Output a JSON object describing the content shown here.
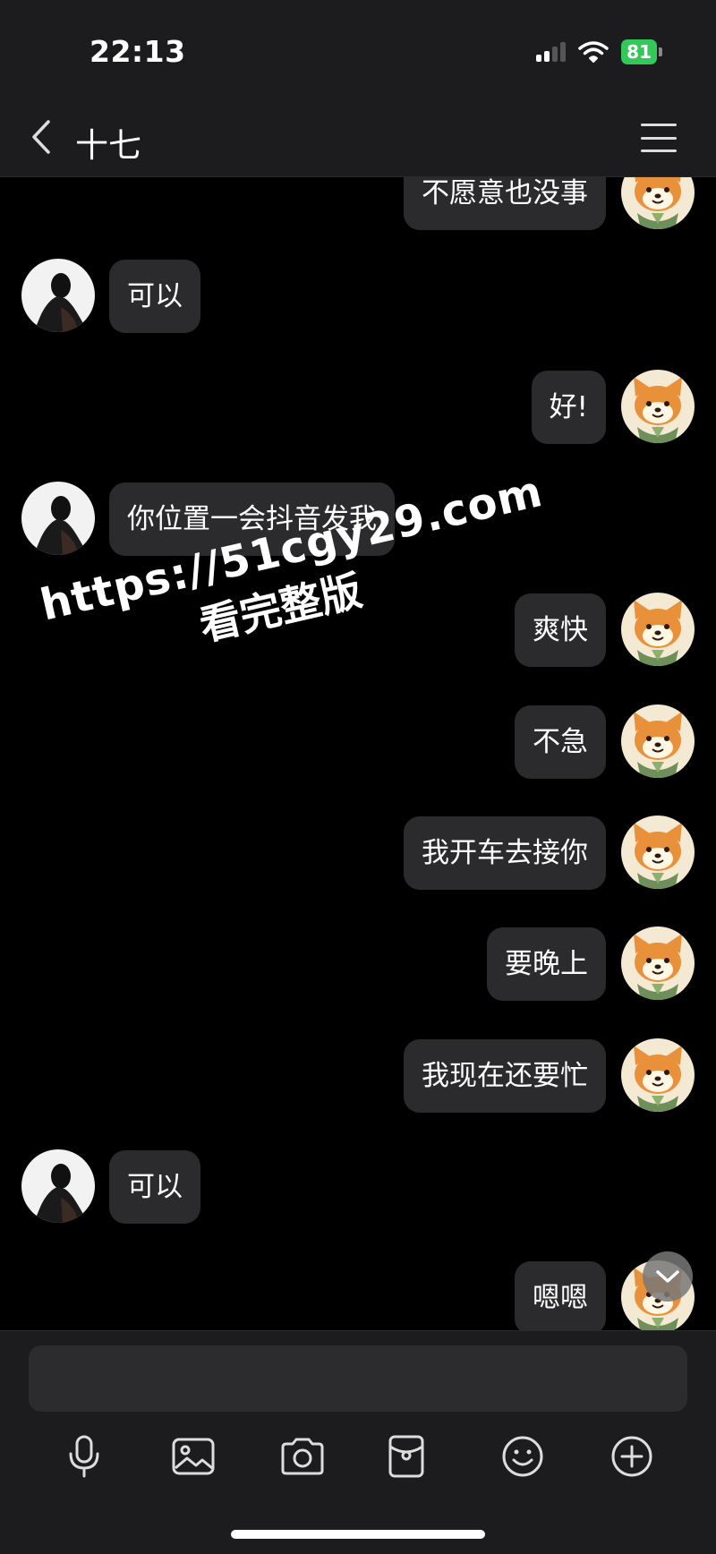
{
  "status_bar": {
    "time": "22:13",
    "battery": "81"
  },
  "nav": {
    "title": "十七"
  },
  "messages": [
    {
      "side": "right",
      "text": "不愿意也没事"
    },
    {
      "side": "left",
      "text": "可以"
    },
    {
      "side": "right",
      "text": "好!"
    },
    {
      "side": "left",
      "text": "你位置一会抖音发我"
    },
    {
      "side": "right",
      "text": "爽快"
    },
    {
      "side": "right",
      "text": "不急"
    },
    {
      "side": "right",
      "text": "我开车去接你"
    },
    {
      "side": "right",
      "text": "要晚上"
    },
    {
      "side": "right",
      "text": "我现在还要忙"
    },
    {
      "side": "left",
      "text": "可以"
    },
    {
      "side": "right",
      "text": "嗯嗯"
    }
  ],
  "watermark": {
    "line1": "https://51cgy29.com",
    "line2": "看完整版"
  },
  "composer": {
    "placeholder": ""
  },
  "toolbar": [
    "microphone-icon",
    "image-icon",
    "camera-icon",
    "red-packet-icon",
    "emoji-icon",
    "plus-icon"
  ],
  "colors": {
    "background": "#000000",
    "bar": "#1c1c1e",
    "bubble": "#2b2b2e",
    "battery": "#34c759"
  }
}
